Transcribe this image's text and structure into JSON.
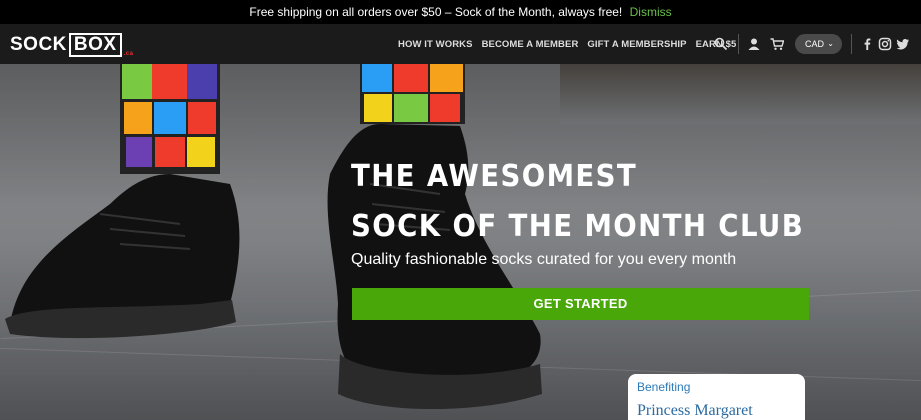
{
  "promo": {
    "message": "Free shipping on all orders over $50 – Sock of the Month, always free!",
    "dismiss": "Dismiss"
  },
  "header": {
    "logo_left": "SOCK",
    "logo_right": "BOX",
    "logo_sub": ".ca",
    "menu": [
      "HOW IT WORKS",
      "BECOME A MEMBER",
      "GIFT A MEMBERSHIP",
      "EARN $5"
    ],
    "currency": "CAD",
    "icons": [
      "search-icon",
      "account-icon",
      "cart-icon",
      "facebook-icon",
      "instagram-icon",
      "twitter-icon"
    ]
  },
  "hero": {
    "title_line1": "THE AWESOMEST",
    "title_line2": "SOCK OF THE MONTH CLUB",
    "subtitle": "Quality fashionable socks curated for you every month",
    "cta": "GET STARTED",
    "benefit_label": "Benefiting",
    "benefit_name": "Princess Margaret"
  },
  "colors": {
    "accent": "#4aa70a",
    "dismiss": "#6cc04a",
    "nav_bg": "#1b1b1b",
    "promo_bg": "#000000",
    "benefit_text": "#2b7ab8"
  }
}
